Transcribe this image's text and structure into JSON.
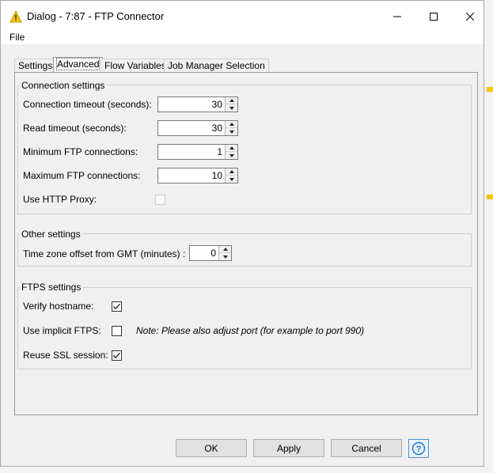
{
  "window": {
    "title": "Dialog - 7:87 - FTP Connector"
  },
  "menu": {
    "file": "File"
  },
  "tabs": [
    {
      "label": "Settings",
      "active": false
    },
    {
      "label": "Advanced",
      "active": true
    },
    {
      "label": "Flow Variables",
      "active": false
    },
    {
      "label": "Job Manager Selection",
      "active": false
    }
  ],
  "connection_settings": {
    "legend": "Connection settings",
    "connection_timeout": {
      "label": "Connection timeout (seconds):",
      "value": "30"
    },
    "read_timeout": {
      "label": "Read timeout (seconds):",
      "value": "30"
    },
    "min_ftp": {
      "label": "Minimum FTP connections:",
      "value": "1"
    },
    "max_ftp": {
      "label": "Maximum FTP connections:",
      "value": "10"
    },
    "use_http_proxy": {
      "label": "Use HTTP Proxy:",
      "checked": false,
      "enabled": false
    }
  },
  "other_settings": {
    "legend": "Other settings",
    "tz_offset": {
      "label": "Time zone offset from GMT (minutes)  :",
      "value": "0"
    }
  },
  "ftps_settings": {
    "legend": "FTPS settings",
    "verify_hostname": {
      "label": "Verify hostname:",
      "checked": true
    },
    "implicit_ftps": {
      "label": "Use implicit FTPS:",
      "checked": false,
      "note": "Note: Please also adjust port (for example to port 990)"
    },
    "reuse_ssl": {
      "label": "Reuse SSL session:",
      "checked": true
    }
  },
  "buttons": {
    "ok": "OK",
    "apply": "Apply",
    "cancel": "Cancel",
    "help": "?"
  },
  "colors": {
    "knime_warning": "#f3c400",
    "help_blue": "#1a73d1"
  }
}
